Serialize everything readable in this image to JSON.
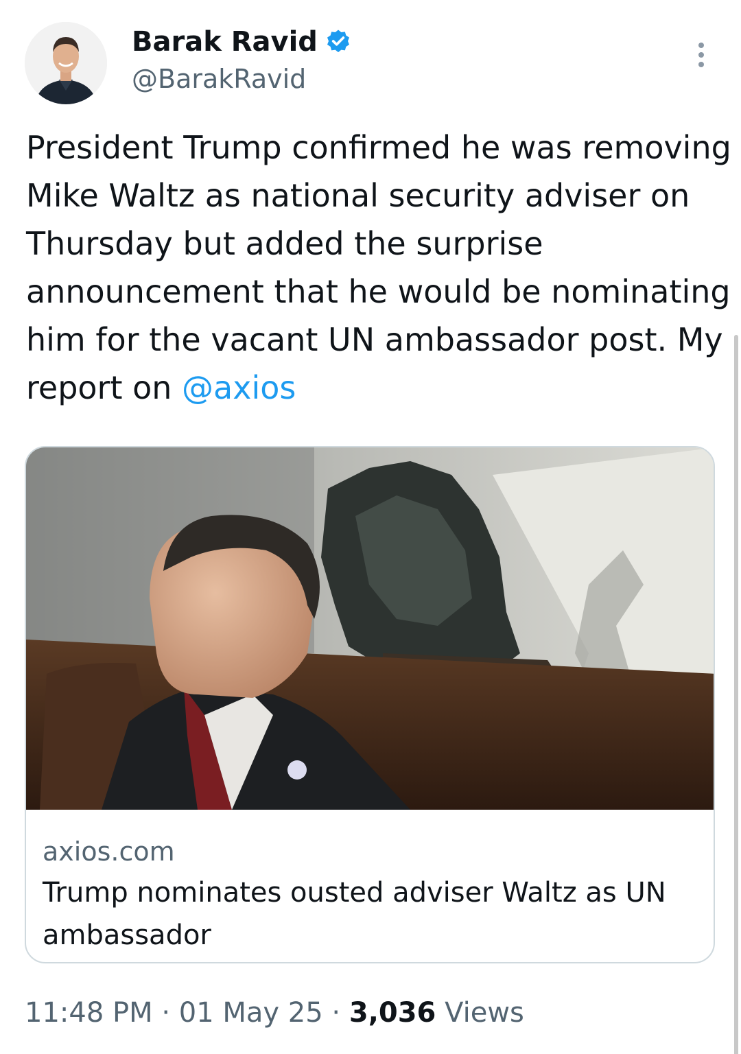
{
  "author": {
    "display_name": "Barak Ravid",
    "handle": "@BarakRavid",
    "verified": true,
    "avatar_icon": "profile-photo"
  },
  "tweet": {
    "text_before_mention": "President Trump confirmed he was removing Mike Waltz as national security adviser on Thursday but added the surprise announcement that he would be nominating him for the vacant UN ambassador post. My report on ",
    "mention": "@axios"
  },
  "link_card": {
    "domain": "axios.com",
    "title": "Trump nominates ousted adviser Waltz as UN ambassador"
  },
  "meta": {
    "time": "11:48 PM",
    "separator": "·",
    "date": "01 May 25",
    "views_count": "3,036",
    "views_label": "Views"
  },
  "colors": {
    "accent": "#1d9bf0",
    "secondary_text": "#536471",
    "primary_text": "#0f1419",
    "border": "#cfd9de"
  },
  "icons": {
    "verified": "verified-badge-icon",
    "more": "more-options-icon"
  }
}
